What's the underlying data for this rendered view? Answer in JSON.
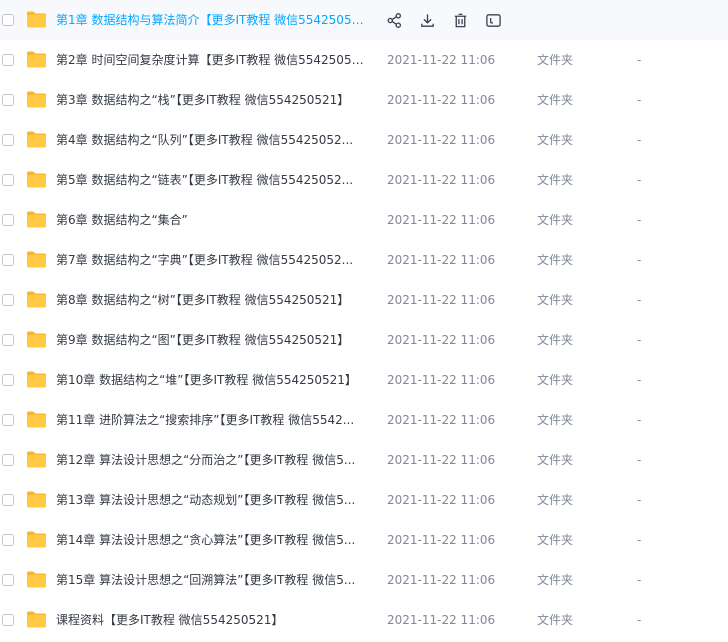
{
  "files": [
    {
      "name": "第1章 数据结构与算法简介【更多IT教程 微信55425052...",
      "modified": "2021-11-22 11:06",
      "type": "文件夹",
      "size": "-",
      "hovered": true
    },
    {
      "name": "第2章 时间空间复杂度计算【更多IT教程 微信55425052...",
      "modified": "2021-11-22 11:06",
      "type": "文件夹",
      "size": "-"
    },
    {
      "name": "第3章 数据结构之“栈”【更多IT教程 微信554250521】",
      "modified": "2021-11-22 11:06",
      "type": "文件夹",
      "size": "-"
    },
    {
      "name": "第4章 数据结构之“队列”【更多IT教程 微信55425052...",
      "modified": "2021-11-22 11:06",
      "type": "文件夹",
      "size": "-"
    },
    {
      "name": "第5章 数据结构之“链表”【更多IT教程 微信55425052...",
      "modified": "2021-11-22 11:06",
      "type": "文件夹",
      "size": "-"
    },
    {
      "name": "第6章 数据结构之“集合”",
      "modified": "2021-11-22 11:06",
      "type": "文件夹",
      "size": "-"
    },
    {
      "name": "第7章 数据结构之“字典”【更多IT教程 微信55425052...",
      "modified": "2021-11-22 11:06",
      "type": "文件夹",
      "size": "-"
    },
    {
      "name": "第8章 数据结构之“树”【更多IT教程 微信554250521】",
      "modified": "2021-11-22 11:06",
      "type": "文件夹",
      "size": "-"
    },
    {
      "name": "第9章 数据结构之“图”【更多IT教程 微信554250521】",
      "modified": "2021-11-22 11:06",
      "type": "文件夹",
      "size": "-"
    },
    {
      "name": "第10章 数据结构之“堆”【更多IT教程 微信554250521】",
      "modified": "2021-11-22 11:06",
      "type": "文件夹",
      "size": "-"
    },
    {
      "name": "第11章 进阶算法之“搜索排序”【更多IT教程 微信5542...",
      "modified": "2021-11-22 11:06",
      "type": "文件夹",
      "size": "-"
    },
    {
      "name": "第12章 算法设计思想之“分而治之”【更多IT教程 微信5...",
      "modified": "2021-11-22 11:06",
      "type": "文件夹",
      "size": "-"
    },
    {
      "name": "第13章 算法设计思想之“动态规划”【更多IT教程 微信5...",
      "modified": "2021-11-22 11:06",
      "type": "文件夹",
      "size": "-"
    },
    {
      "name": "第14章 算法设计思想之“贪心算法”【更多IT教程 微信5...",
      "modified": "2021-11-22 11:06",
      "type": "文件夹",
      "size": "-"
    },
    {
      "name": "第15章 算法设计思想之“回溯算法”【更多IT教程 微信5...",
      "modified": "2021-11-22 11:06",
      "type": "文件夹",
      "size": "-"
    },
    {
      "name": "课程资料【更多IT教程 微信554250521】",
      "modified": "2021-11-22 11:06",
      "type": "文件夹",
      "size": "-"
    }
  ],
  "row_actions": [
    {
      "icon": "share-icon"
    },
    {
      "icon": "download-icon"
    },
    {
      "icon": "delete-icon"
    },
    {
      "icon": "rename-icon"
    }
  ],
  "colors": {
    "folder": "#ffcb45",
    "folder_tab": "#f7b82b",
    "hover_row": "#f7f9fc",
    "hover_text": "#06a7ff",
    "meta_text": "#818999"
  }
}
